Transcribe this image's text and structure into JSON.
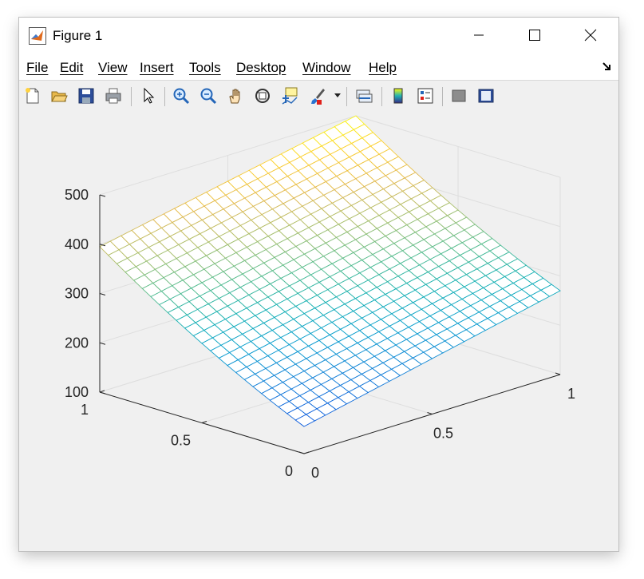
{
  "window": {
    "title": "Figure 1"
  },
  "menu": {
    "items": [
      {
        "label": "File"
      },
      {
        "label": "Edit"
      },
      {
        "label": "View"
      },
      {
        "label": "Insert"
      },
      {
        "label": "Tools"
      },
      {
        "label": "Desktop"
      },
      {
        "label": "Window"
      },
      {
        "label": "Help"
      }
    ]
  },
  "toolbar": {
    "buttons": [
      "new-figure-icon",
      "open-file-icon",
      "save-icon",
      "print-icon",
      "pointer-icon",
      "zoom-in-icon",
      "zoom-out-icon",
      "pan-hand-icon",
      "rotate-3d-icon",
      "data-cursor-icon",
      "brush-icon",
      "link-plot-icon",
      "colorbar-icon",
      "legend-icon",
      "hide-plot-tools-icon",
      "show-plot-tools-icon"
    ]
  },
  "chart_data": {
    "type": "surface",
    "x_ticks": [
      "0",
      "0.5",
      "1"
    ],
    "y_ticks": [
      "0",
      "0.5",
      "1"
    ],
    "z_ticks": [
      "100",
      "200",
      "300",
      "400",
      "500"
    ],
    "xlim": [
      0,
      1
    ],
    "ylim": [
      0,
      1
    ],
    "zlim": [
      100,
      500
    ],
    "grid": true,
    "corner_z": {
      "x0_y0": 155,
      "x1_y0": 270,
      "x0_y1": 395,
      "x1_y1": 500
    },
    "colormap": "parula",
    "mesh_lines": 25
  }
}
